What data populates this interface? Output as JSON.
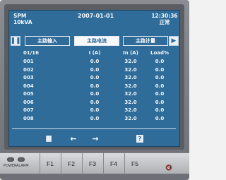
{
  "header": {
    "mode": "SPM",
    "capacity": "10kVA",
    "date": "2007-01-01",
    "time": "12:30:36",
    "status": "正常"
  },
  "tabs": [
    {
      "label": "主路输入"
    },
    {
      "label": "主路电流"
    },
    {
      "label": "主路计量"
    }
  ],
  "table": {
    "headers": [
      "01/16",
      "I (A)",
      "In (A)",
      "Load%"
    ],
    "rows": [
      [
        "001",
        "0.0",
        "32.0",
        "0.0"
      ],
      [
        "002",
        "0.0",
        "32.0",
        "0.0"
      ],
      [
        "003",
        "0.0",
        "32.0",
        "0.0"
      ],
      [
        "004",
        "0.0",
        "32.0",
        "0.0"
      ],
      [
        "005",
        "0.0",
        "32.0",
        "0.0"
      ],
      [
        "006",
        "0.0",
        "32.0",
        "0.0"
      ],
      [
        "007",
        "0.0",
        "32.0",
        "0.0"
      ],
      [
        "008",
        "0.0",
        "32.0",
        "0.0"
      ]
    ]
  },
  "bottom": {
    "prev": "←",
    "next": "→",
    "help": "?"
  },
  "panel": {
    "power_label": "POWER",
    "alarm_label": "ALARM",
    "fkeys": [
      "F1",
      "F2",
      "F3",
      "F4",
      "F5"
    ]
  },
  "colors": {
    "screen_bg": "#2f6c9a",
    "text": "#f2f6fa"
  }
}
